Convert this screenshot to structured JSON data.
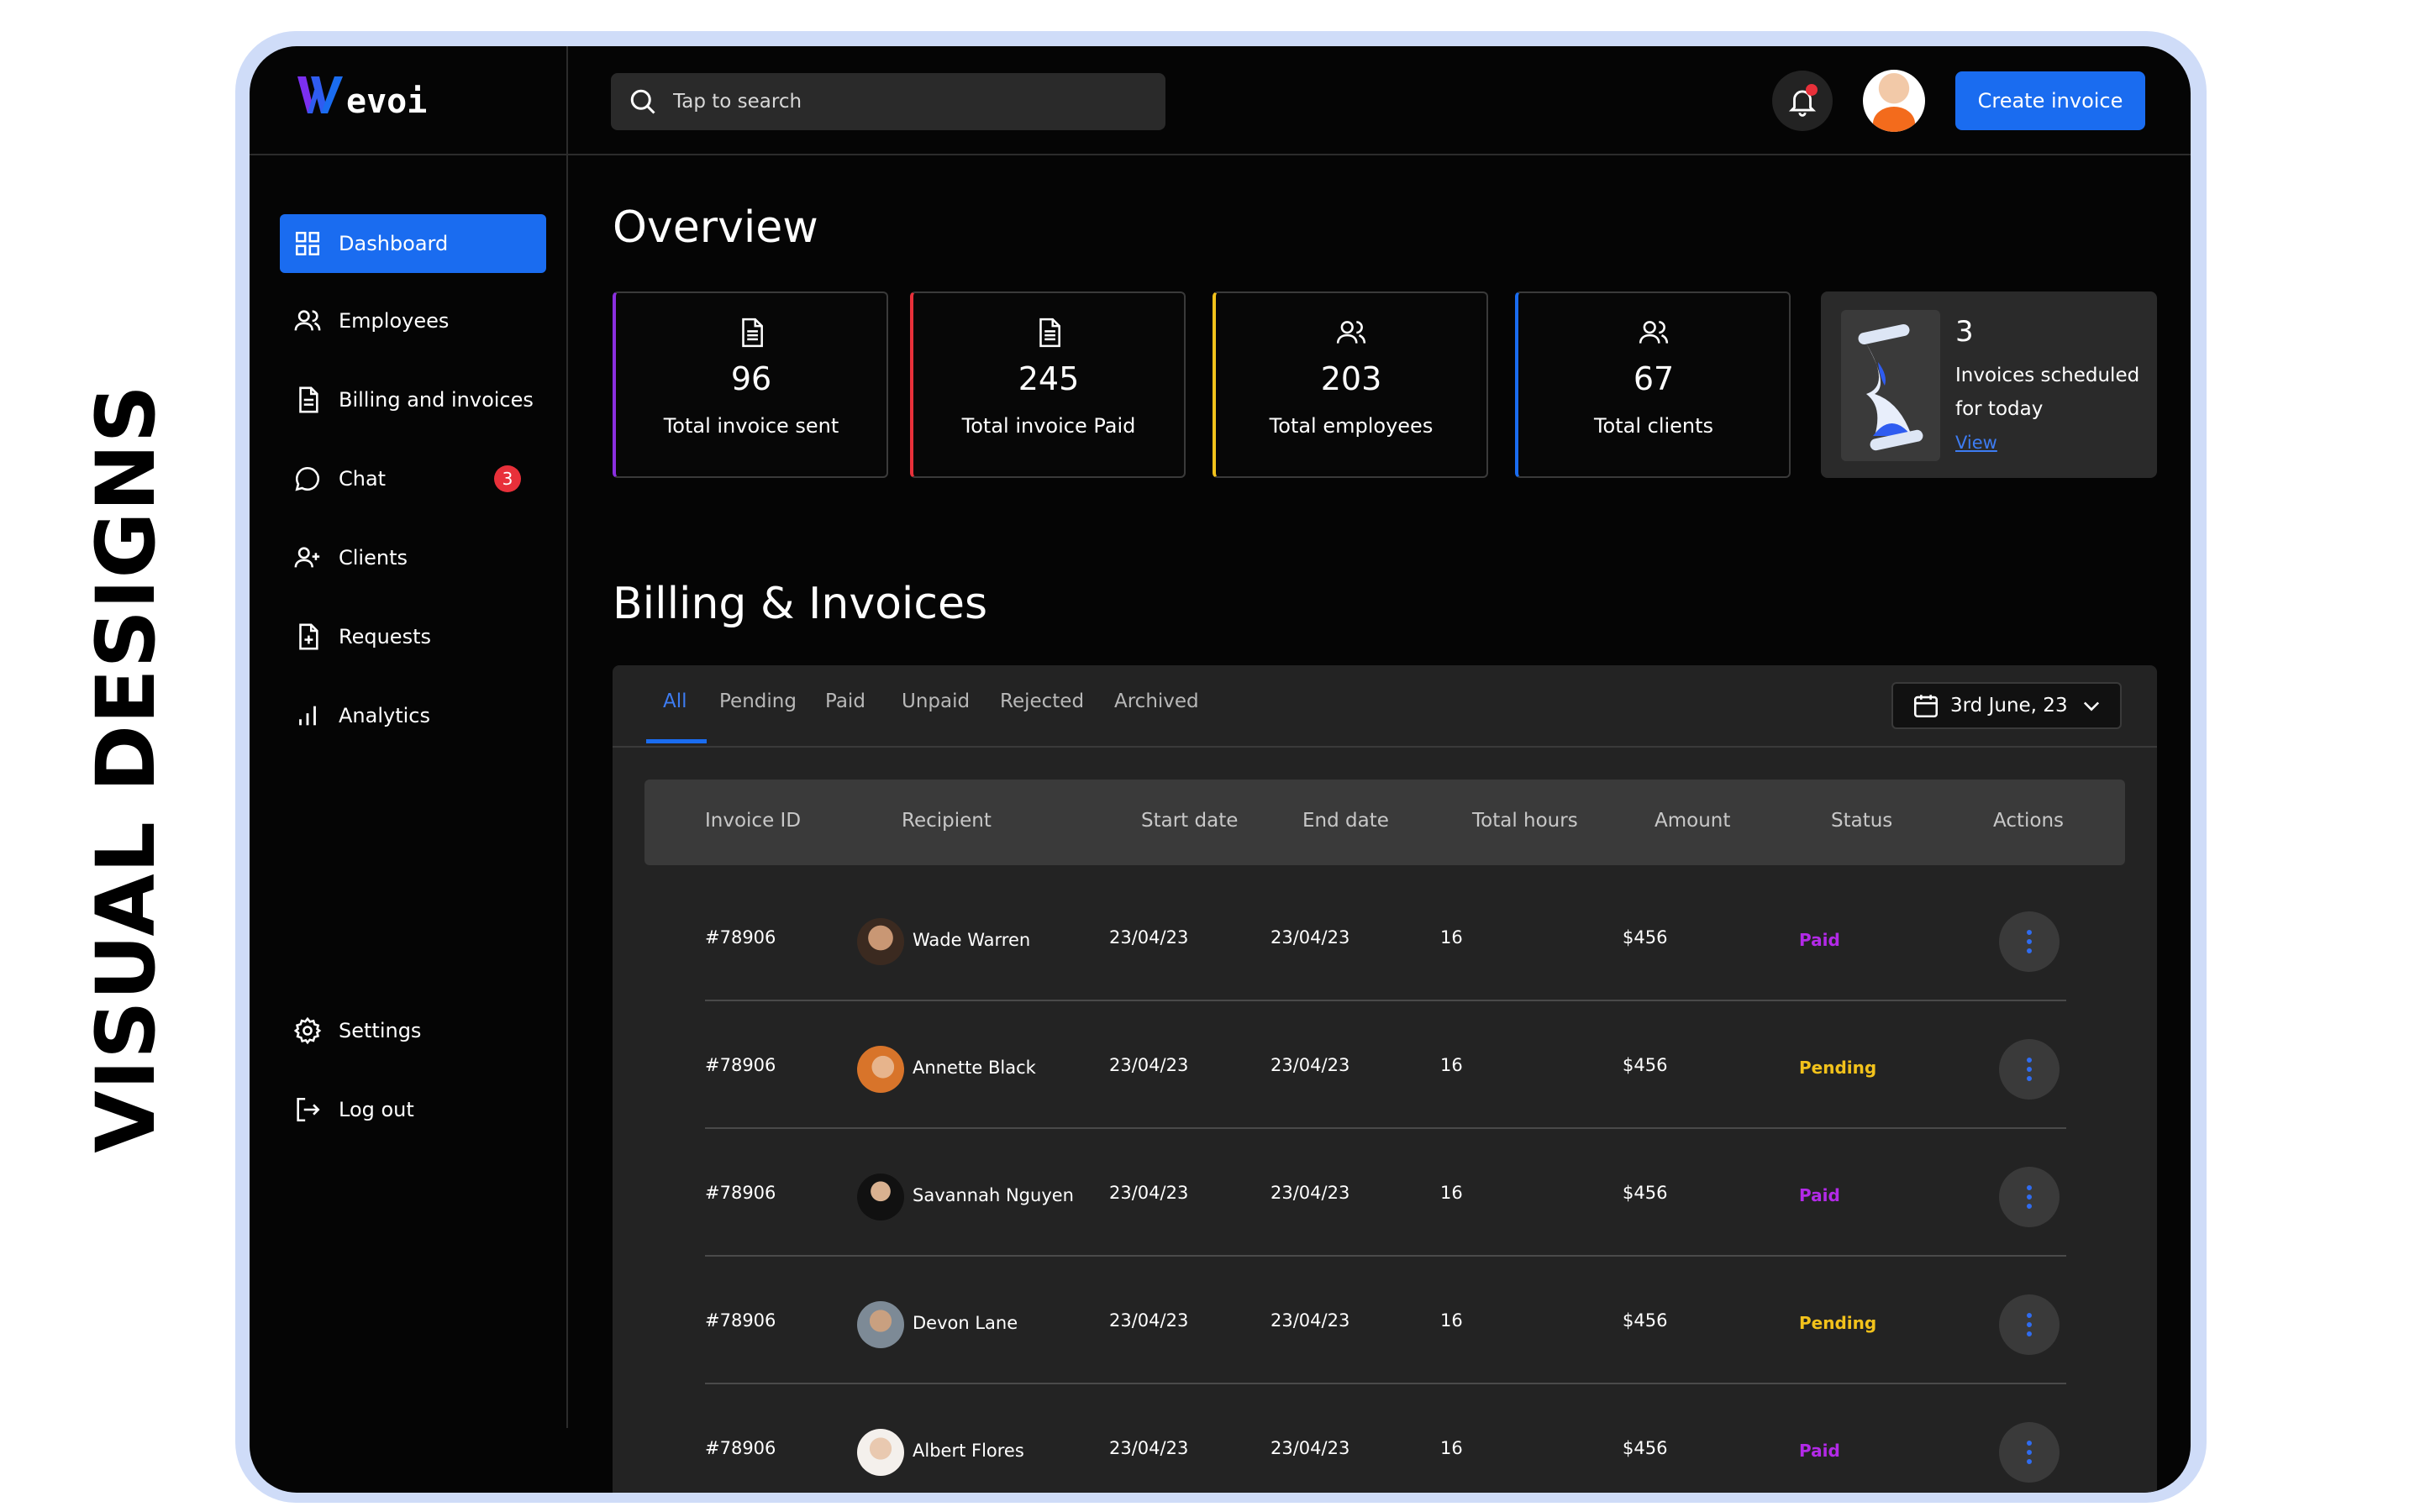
{
  "side_heading": "VISUAL DESIGNS",
  "brand": {
    "logo_text": "evoi",
    "accent": "#1a6cf0"
  },
  "search": {
    "placeholder": "Tap to search"
  },
  "header": {
    "create_label": "Create invoice"
  },
  "sidebar": {
    "items": [
      {
        "label": "Dashboard",
        "icon": "grid-icon",
        "active": true
      },
      {
        "label": "Employees",
        "icon": "users-icon"
      },
      {
        "label": "Billing and invoices",
        "icon": "document-icon"
      },
      {
        "label": "Chat",
        "icon": "chat-icon",
        "badge": "3"
      },
      {
        "label": "Clients",
        "icon": "user-plus-icon"
      },
      {
        "label": "Requests",
        "icon": "file-plus-icon"
      },
      {
        "label": "Analytics",
        "icon": "bar-chart-icon"
      }
    ],
    "bottom": [
      {
        "label": "Settings",
        "icon": "gear-icon"
      },
      {
        "label": "Log out",
        "icon": "logout-icon"
      }
    ]
  },
  "overview": {
    "title": "Overview",
    "stats": [
      {
        "value": "96",
        "label": "Total invoice sent",
        "icon": "document-icon",
        "color": "#8b2fe0"
      },
      {
        "value": "245",
        "label": "Total invoice Paid",
        "icon": "document-icon",
        "color": "#e8303a"
      },
      {
        "value": "203",
        "label": "Total employees",
        "icon": "users-icon",
        "color": "#f2c21b"
      },
      {
        "value": "67",
        "label": "Total clients",
        "icon": "users-icon",
        "color": "#1a6cf0"
      }
    ],
    "scheduled": {
      "count": "3",
      "text": "Invoices scheduled for today",
      "link": "View"
    }
  },
  "billing": {
    "title": "Billing & Invoices",
    "tabs": [
      "All",
      "Pending",
      "Paid",
      "Unpaid",
      "Rejected",
      "Archived"
    ],
    "active_tab": "All",
    "date_filter": "3rd June, 23",
    "columns": [
      "Invoice ID",
      "Recipient",
      "Start date",
      "End date",
      "Total hours",
      "Amount",
      "Status",
      "Actions"
    ],
    "rows": [
      {
        "id": "#78906",
        "recipient": "Wade Warren",
        "start": "23/04/23",
        "end": "23/04/23",
        "hours": "16",
        "amount": "$456",
        "status": "Paid"
      },
      {
        "id": "#78906",
        "recipient": "Annette Black",
        "start": "23/04/23",
        "end": "23/04/23",
        "hours": "16",
        "amount": "$456",
        "status": "Pending"
      },
      {
        "id": "#78906",
        "recipient": "Savannah Nguyen",
        "start": "23/04/23",
        "end": "23/04/23",
        "hours": "16",
        "amount": "$456",
        "status": "Paid"
      },
      {
        "id": "#78906",
        "recipient": "Devon Lane",
        "start": "23/04/23",
        "end": "23/04/23",
        "hours": "16",
        "amount": "$456",
        "status": "Pending"
      },
      {
        "id": "#78906",
        "recipient": "Albert Flores",
        "start": "23/04/23",
        "end": "23/04/23",
        "hours": "16",
        "amount": "$456",
        "status": "Paid"
      }
    ],
    "status_colors": {
      "Paid": "#b32ae8",
      "Pending": "#f2c21b"
    }
  }
}
